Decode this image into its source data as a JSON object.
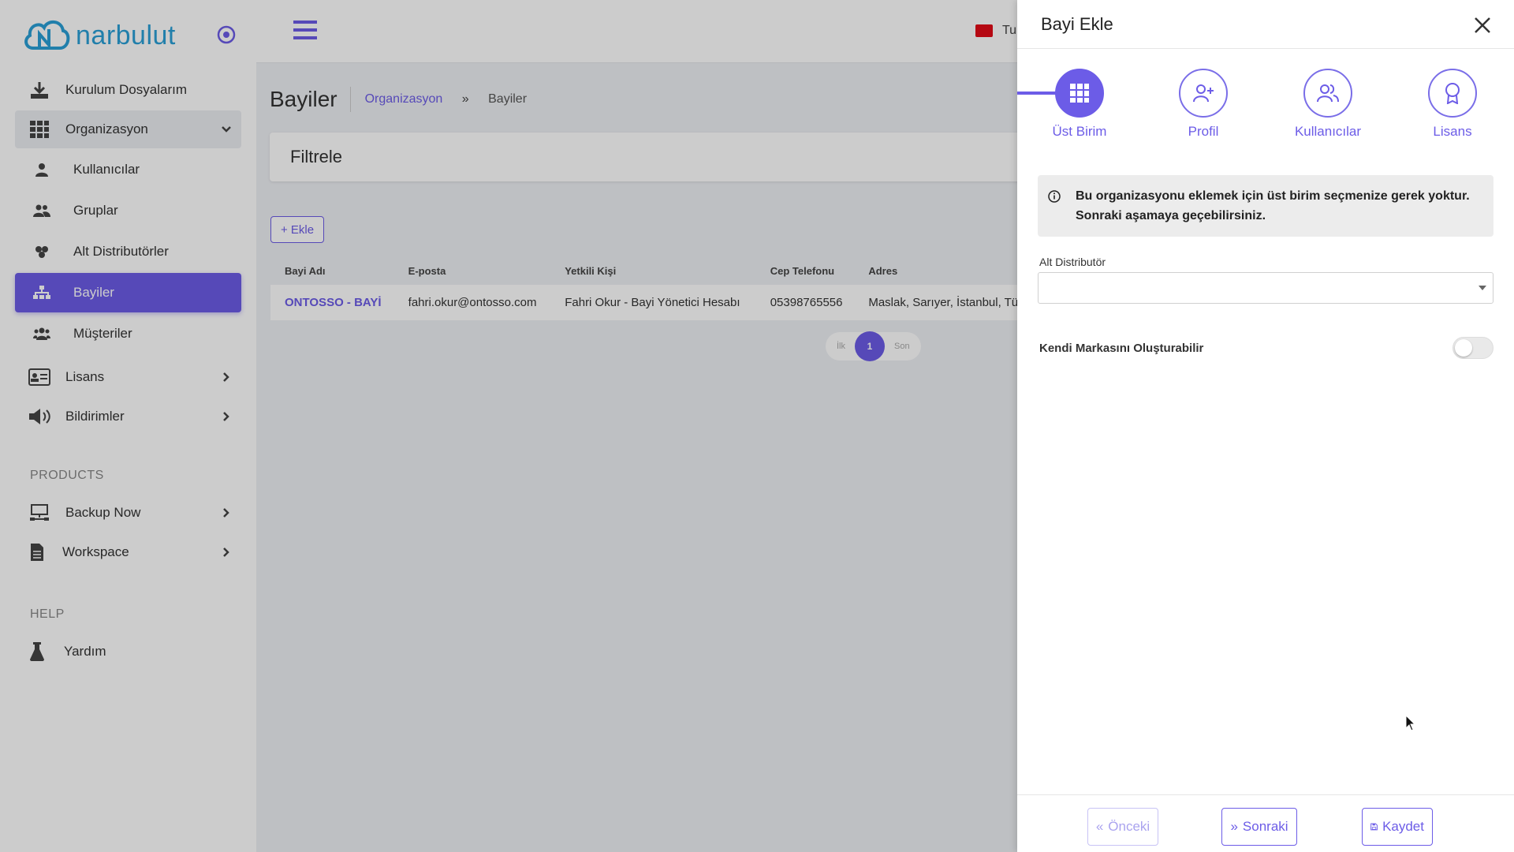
{
  "app": {
    "logo_text": "narbulut"
  },
  "sidebar": {
    "items": [
      {
        "label": "Kurulum Dosyalarım"
      },
      {
        "label": "Organizasyon"
      },
      {
        "label": "Kullanıcılar"
      },
      {
        "label": "Gruplar"
      },
      {
        "label": "Alt Distributörler"
      },
      {
        "label": "Bayiler"
      },
      {
        "label": "Müşteriler"
      },
      {
        "label": "Lisans"
      },
      {
        "label": "Bildirimler"
      }
    ],
    "products_label": "PRODUCTS",
    "products": [
      {
        "label": "Backup Now"
      },
      {
        "label": "Workspace"
      }
    ],
    "help_label": "HELP",
    "help": [
      {
        "label": "Yardım"
      }
    ]
  },
  "topbar": {
    "lang": "Tu"
  },
  "page": {
    "title": "Bayiler",
    "breadcrumb": {
      "parent": "Organizasyon",
      "current": "Bayiler"
    },
    "filter_title": "Filtrele",
    "add_label": "+ Ekle"
  },
  "table": {
    "headers": [
      "Bayi Adı",
      "E-posta",
      "Yetkili Kişi",
      "Cep Telefonu",
      "Adres"
    ],
    "rows": [
      [
        "ONTOSSO - BAYİ",
        "fahri.okur@ontosso.com",
        "Fahri Okur - Bayi Yönetici Hesabı",
        "05398765556",
        "Maslak, Sarıyer, İstanbul, Türkiye"
      ]
    ]
  },
  "pager": {
    "first": "İlk",
    "page": "1",
    "last": "Son"
  },
  "drawer": {
    "title": "Bayi Ekle",
    "steps": [
      {
        "label": "Üst Birim"
      },
      {
        "label": "Profil"
      },
      {
        "label": "Kullanıcılar"
      },
      {
        "label": "Lisans"
      }
    ],
    "info_text": "Bu organizasyonu eklemek için üst birim seçmenize gerek yoktur. Sonraki aşamaya geçebilirsiniz.",
    "field_label": "Alt Distributör",
    "select_value": "",
    "toggle_label": "Kendi Markasını Oluşturabilir",
    "toggle_on": false,
    "prev_label": "Önceki",
    "next_label": "Sonraki",
    "save_label": "Kaydet"
  },
  "colors": {
    "accent": "#6c5ce7",
    "logo": "#2a9fd6"
  }
}
